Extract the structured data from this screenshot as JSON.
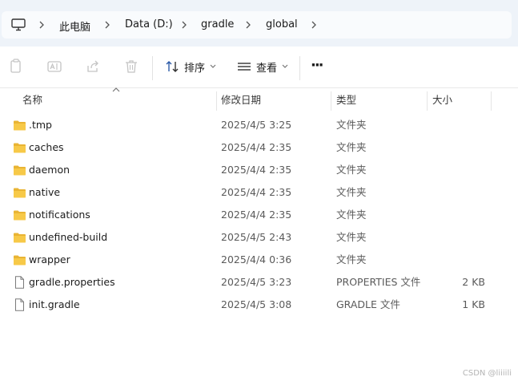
{
  "breadcrumb": {
    "items": [
      "此电脑",
      "Data (D:)",
      "gradle",
      "global"
    ]
  },
  "toolbar": {
    "sort_label": "排序",
    "view_label": "查看",
    "more_label": "···"
  },
  "columns": {
    "name": "名称",
    "date": "修改日期",
    "type": "类型",
    "size": "大小"
  },
  "files": [
    {
      "name": ".tmp",
      "date": "2025/4/5 3:25",
      "type": "文件夹",
      "size": "",
      "kind": "folder"
    },
    {
      "name": "caches",
      "date": "2025/4/4 2:35",
      "type": "文件夹",
      "size": "",
      "kind": "folder"
    },
    {
      "name": "daemon",
      "date": "2025/4/4 2:35",
      "type": "文件夹",
      "size": "",
      "kind": "folder"
    },
    {
      "name": "native",
      "date": "2025/4/4 2:35",
      "type": "文件夹",
      "size": "",
      "kind": "folder"
    },
    {
      "name": "notifications",
      "date": "2025/4/4 2:35",
      "type": "文件夹",
      "size": "",
      "kind": "folder"
    },
    {
      "name": "undefined-build",
      "date": "2025/4/5 2:43",
      "type": "文件夹",
      "size": "",
      "kind": "folder"
    },
    {
      "name": "wrapper",
      "date": "2025/4/4 0:36",
      "type": "文件夹",
      "size": "",
      "kind": "folder"
    },
    {
      "name": "gradle.properties",
      "date": "2025/4/5 3:23",
      "type": "PROPERTIES 文件",
      "size": "2 KB",
      "kind": "file"
    },
    {
      "name": "init.gradle",
      "date": "2025/4/5 3:08",
      "type": "GRADLE 文件",
      "size": "1 KB",
      "kind": "file"
    }
  ],
  "watermark": "CSDN @liiiili",
  "colors": {
    "folder": "#f7c948",
    "folder_dark": "#e9b434",
    "addr_bg": "#eef3f9"
  }
}
